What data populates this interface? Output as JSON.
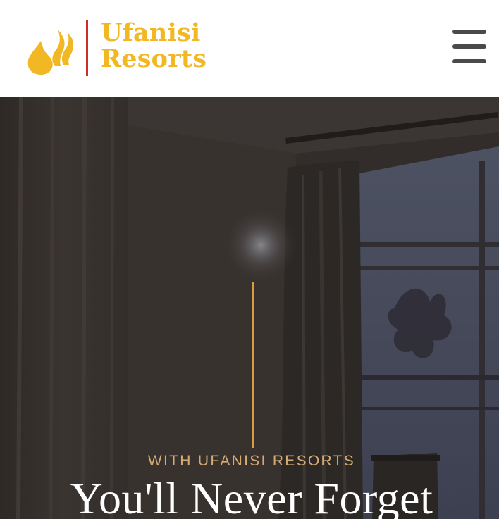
{
  "header": {
    "logo": {
      "line1": "Ufanisi",
      "line2": "Resorts",
      "mark_icon": "flame-icon",
      "colors": {
        "text": "#f2b824",
        "divider": "#c9302c"
      }
    },
    "menu_icon": "hamburger-menu-icon"
  },
  "hero": {
    "kicker": "WITH UFANISI RESORTS",
    "title": "You'll Never Forget",
    "colors": {
      "overlay": "#302b28",
      "rule": "#d99a46",
      "kicker": "#d6ab73",
      "title": "#ffffff"
    }
  }
}
